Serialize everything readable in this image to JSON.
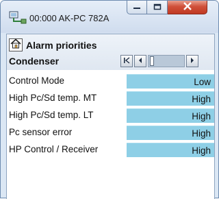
{
  "window": {
    "title": "00:000 AK-PC 782A",
    "app_icon": "network-monitor-icon",
    "controls": {
      "minimize_icon": "minimize-icon",
      "maximize_icon": "maximize-icon",
      "close_icon": "close-icon"
    }
  },
  "page": {
    "title": "Alarm priorities",
    "home_icon": "home-icon",
    "section": "Condenser",
    "nav": {
      "first_icon": "skip-first-icon",
      "prev_icon": "previous-icon",
      "next_icon": "next-icon"
    }
  },
  "rows": [
    {
      "label": "Control Mode",
      "value": "Low"
    },
    {
      "label": "High Pc/Sd temp. MT",
      "value": "High"
    },
    {
      "label": "High Pc/Sd temp. LT",
      "value": "High"
    },
    {
      "label": "Pc sensor error",
      "value": "High"
    },
    {
      "label": "HP Control / Receiver",
      "value": "High"
    }
  ],
  "colors": {
    "value_cell": "#8ecfe6",
    "close_button": "#c8432c",
    "window_frame": "#dbe7f4"
  }
}
